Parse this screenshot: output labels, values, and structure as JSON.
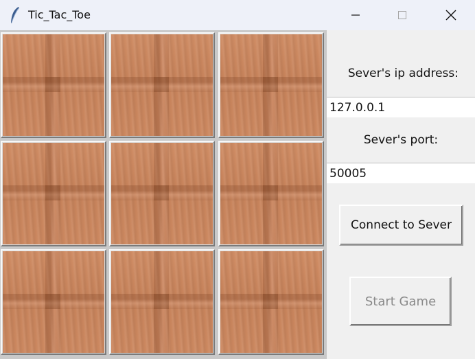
{
  "window": {
    "title": "Tic_Tac_Toe",
    "icon": "feather-icon",
    "controls": [
      "minimize-icon",
      "maximize-icon",
      "close-icon"
    ]
  },
  "board": {
    "cells": [
      "",
      "",
      "",
      "",
      "",
      "",
      "",
      "",
      ""
    ],
    "texture": "wood-plank"
  },
  "panel": {
    "ip_label": "Sever's ip address:",
    "ip_value": "127.0.0.1",
    "port_label": "Sever's port:",
    "port_value": "50005",
    "connect_label": "Connect to Sever",
    "start_label": "Start Game",
    "start_disabled": true
  },
  "colors": {
    "titlebar_bg": "#eef1f9",
    "panel_bg": "#f0f0f0",
    "wood": "#c9855d",
    "disabled_text": "#8a8a8a"
  }
}
